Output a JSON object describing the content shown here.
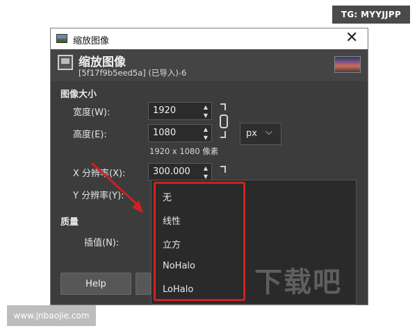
{
  "watermark_top": "TG: MYYJJPP",
  "watermark_bottom": "www.jnbaojie.com",
  "watermark_center": "下载吧",
  "window": {
    "title": "缩放图像",
    "close_glyph": "✕"
  },
  "header": {
    "title": "缩放图像",
    "subtitle": "[5f17f9b5eed5a] (已导入)-6"
  },
  "image_size": {
    "section_label": "图像大小",
    "width_label": "宽度(W):",
    "width_value": "1920",
    "height_label": "高度(E):",
    "height_value": "1080",
    "unit": "px",
    "size_note": "1920 x 1080 像素"
  },
  "resolution": {
    "x_label": "X 分辨率(X):",
    "x_value": "300.000",
    "y_label": "Y 分辨率(Y):"
  },
  "quality": {
    "section_label": "质量",
    "interp_label": "插值(N):",
    "options": [
      "无",
      "线性",
      "立方",
      "NoHalo",
      "LoHalo"
    ]
  },
  "buttons": {
    "help": "Help"
  },
  "colors": {
    "accent_red": "#d21f1f",
    "window_bg": "#3c3c3c"
  }
}
